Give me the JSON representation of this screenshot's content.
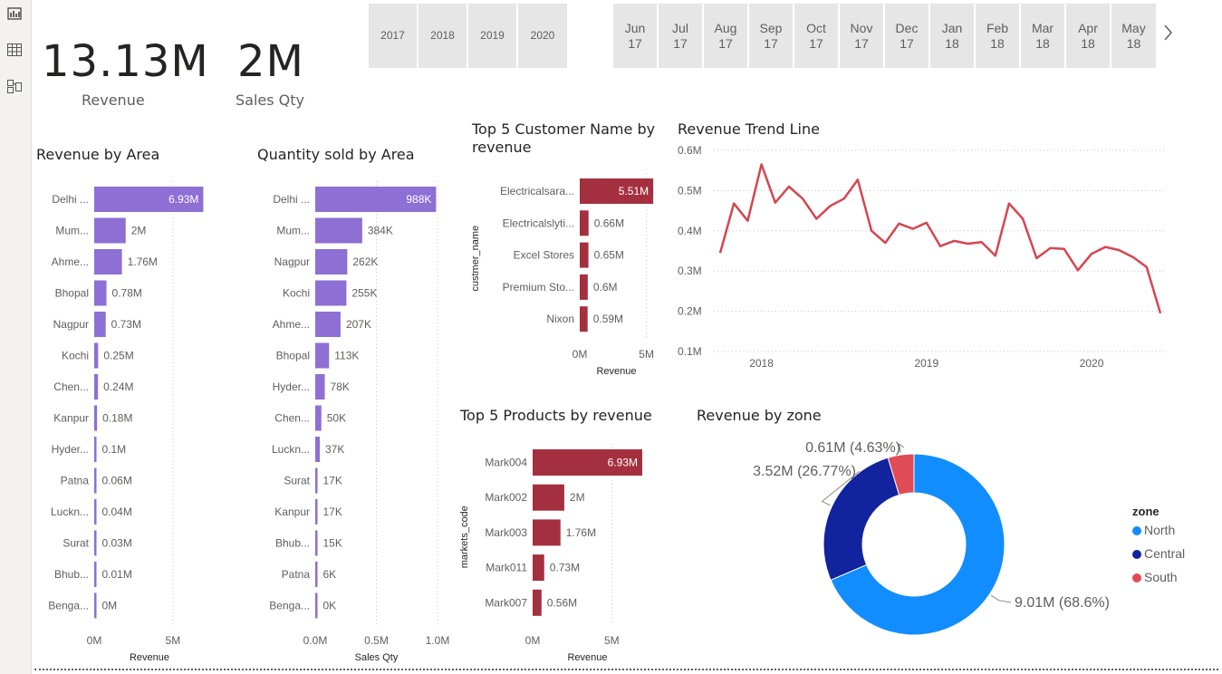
{
  "kpis": {
    "revenue": {
      "value": "13.13M",
      "label": "Revenue"
    },
    "qty": {
      "value": "2M",
      "label": "Sales Qty"
    }
  },
  "years": [
    "2017",
    "2018",
    "2019",
    "2020"
  ],
  "months": [
    "Jun\n17",
    "Jul\n17",
    "Aug\n17",
    "Sep\n17",
    "Oct\n17",
    "Nov\n17",
    "Dec\n17",
    "Jan\n18",
    "Feb\n18",
    "Mar\n18",
    "Apr\n18",
    "May\n18"
  ],
  "nav": {
    "next_icon": "chevron-right-icon"
  },
  "colors": {
    "purple": "#8e6fd4",
    "maroon": "#a4303f",
    "trend": "#d64550",
    "north": "#118dff",
    "central": "#12239e",
    "south": "#e04b58"
  },
  "chart_data": [
    {
      "type": "bar",
      "orientation": "horizontal",
      "title": "Revenue by Area",
      "xlabel": "Revenue",
      "categories": [
        "Delhi ...",
        "Mum...",
        "Ahme...",
        "Bhopal",
        "Nagpur",
        "Kochi",
        "Chen...",
        "Kanpur",
        "Hyder...",
        "Patna",
        "Luckn...",
        "Surat",
        "Bhub...",
        "Benga..."
      ],
      "values": [
        6.93,
        2.0,
        1.76,
        0.78,
        0.73,
        0.25,
        0.24,
        0.18,
        0.1,
        0.06,
        0.04,
        0.03,
        0.01,
        0.0
      ],
      "labels": [
        "6.93M",
        "2M",
        "1.76M",
        "0.78M",
        "0.73M",
        "0.25M",
        "0.24M",
        "0.18M",
        "0.1M",
        "0.06M",
        "0.04M",
        "0.03M",
        "0.01M",
        "0M"
      ],
      "xlim": [
        0,
        7.02
      ],
      "ticks": [
        0,
        5
      ],
      "tick_labels": [
        "0M",
        "5M"
      ],
      "color": "#8e6fd4"
    },
    {
      "type": "bar",
      "orientation": "horizontal",
      "title": "Quantity sold by Area",
      "xlabel": "Sales Qty",
      "categories": [
        "Delhi ...",
        "Mum...",
        "Nagpur",
        "Kochi",
        "Ahme...",
        "Bhopal",
        "Hyder...",
        "Chen...",
        "Luckn...",
        "Surat",
        "Kanpur",
        "Bhub...",
        "Patna",
        "Benga..."
      ],
      "values": [
        988,
        384,
        262,
        255,
        207,
        113,
        78,
        50,
        37,
        17,
        17,
        15,
        6,
        0
      ],
      "labels": [
        "988K",
        "384K",
        "262K",
        "255K",
        "207K",
        "113K",
        "78K",
        "50K",
        "37K",
        "17K",
        "17K",
        "15K",
        "6K",
        "0K"
      ],
      "xlim": [
        0,
        1000
      ],
      "ticks": [
        0,
        500,
        1000
      ],
      "tick_labels": [
        "0.0M",
        "0.5M",
        "1.0M"
      ],
      "color": "#8e6fd4"
    },
    {
      "type": "bar",
      "orientation": "horizontal",
      "title": "Top 5 Customer Name by revenue",
      "xlabel": "Revenue",
      "ylabel": "custmer_name",
      "categories": [
        "Electricalsara...",
        "Electricalslyti...",
        "Excel Stores",
        "Premium Sto...",
        "Nixon"
      ],
      "values": [
        5.51,
        0.66,
        0.65,
        0.6,
        0.59
      ],
      "labels": [
        "5.51M",
        "0.66M",
        "0.65M",
        "0.6M",
        "0.59M"
      ],
      "xlim": [
        0,
        5.5
      ],
      "ticks": [
        0,
        5
      ],
      "tick_labels": [
        "0M",
        "5M"
      ],
      "color": "#a4303f"
    },
    {
      "type": "line",
      "title": "Revenue Trend Line",
      "x_start": "2017-10",
      "x_end": "2020-06",
      "x_ticks": [
        "2018",
        "2019",
        "2020"
      ],
      "ylim": [
        0.1,
        0.6
      ],
      "y_ticks": [
        0.1,
        0.2,
        0.3,
        0.4,
        0.5,
        0.6
      ],
      "y_tick_labels": [
        "0.1M",
        "0.2M",
        "0.3M",
        "0.4M",
        "0.5M",
        "0.6M"
      ],
      "values": [
        0.345,
        0.468,
        0.425,
        0.565,
        0.47,
        0.51,
        0.48,
        0.43,
        0.462,
        0.48,
        0.527,
        0.4,
        0.37,
        0.418,
        0.405,
        0.42,
        0.362,
        0.375,
        0.368,
        0.372,
        0.338,
        0.468,
        0.43,
        0.332,
        0.357,
        0.355,
        0.302,
        0.343,
        0.36,
        0.352,
        0.335,
        0.31,
        0.195
      ],
      "color": "#d64550",
      "grid": true
    },
    {
      "type": "bar",
      "orientation": "horizontal",
      "title": "Top 5 Products by revenue",
      "xlabel": "Revenue",
      "ylabel": "markets_code",
      "categories": [
        "Mark004",
        "Mark002",
        "Mark003",
        "Mark011",
        "Mark007"
      ],
      "values": [
        6.93,
        2.0,
        1.76,
        0.73,
        0.56
      ],
      "labels": [
        "6.93M",
        "2M",
        "1.76M",
        "0.73M",
        "0.56M"
      ],
      "xlim": [
        0,
        6.93
      ],
      "ticks": [
        0,
        5
      ],
      "tick_labels": [
        "0M",
        "5M"
      ],
      "color": "#a4303f"
    },
    {
      "type": "pie",
      "donut": true,
      "title": "Revenue by zone",
      "legend_title": "zone",
      "slices": [
        {
          "name": "North",
          "value": 9.01,
          "label": "9.01M (68.6%)",
          "color": "#118dff"
        },
        {
          "name": "Central",
          "value": 3.52,
          "label": "3.52M (26.77%)",
          "color": "#12239e"
        },
        {
          "name": "South",
          "value": 0.61,
          "label": "0.61M (4.63%)",
          "color": "#e04b58"
        }
      ]
    }
  ]
}
